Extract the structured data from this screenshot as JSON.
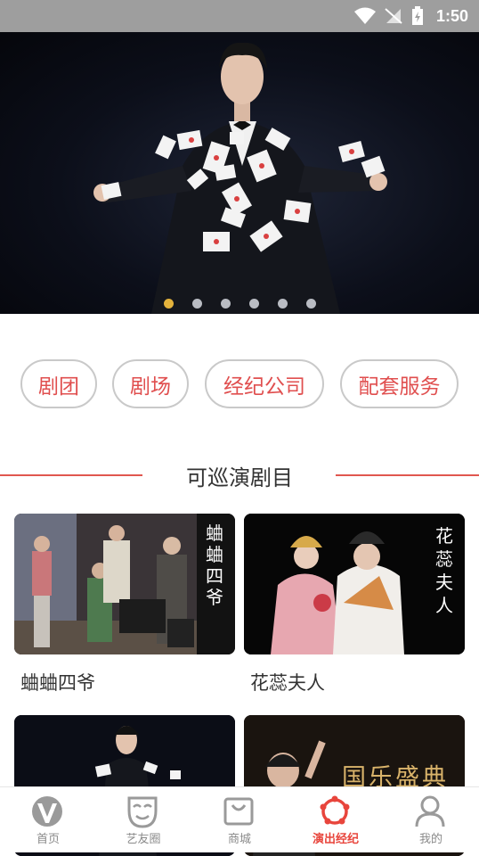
{
  "status_bar": {
    "time": "1:50"
  },
  "banner": {
    "slide_count": 6,
    "active_index": 0
  },
  "categories": [
    "剧团",
    "剧场",
    "经纪公司",
    "配套服务"
  ],
  "section": {
    "title": "可巡演剧目"
  },
  "works": [
    {
      "title": "蛐蛐四爷",
      "poster_text": "蛐蛐四爷"
    },
    {
      "title": "花蕊夫人",
      "poster_text": "花蕊夫人"
    },
    {
      "title": "",
      "poster_text": ""
    },
    {
      "title": "",
      "poster_text": "国乐盛典"
    }
  ],
  "tabbar": {
    "items": [
      {
        "label": "首页",
        "icon": "home-logo-icon"
      },
      {
        "label": "艺友圈",
        "icon": "mask-icon"
      },
      {
        "label": "商城",
        "icon": "shopping-bag-icon"
      },
      {
        "label": "演出经纪",
        "icon": "flower-icon"
      },
      {
        "label": "我的",
        "icon": "person-icon"
      }
    ],
    "active_index": 3
  },
  "colors": {
    "accent": "#e8453c",
    "pill_text": "#e04f4f",
    "dot_active": "#e3b23c"
  }
}
